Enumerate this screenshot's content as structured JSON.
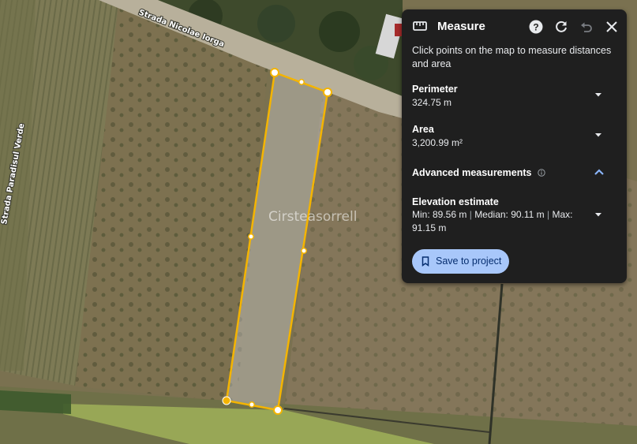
{
  "map": {
    "street_labels": [
      "Strada Nicolae Iorga",
      "Strada Paradisul Verde"
    ],
    "watermark": "Cirsteasorrell",
    "polygon_color": "#f4b400"
  },
  "panel": {
    "title": "Measure",
    "icons": [
      "ruler-icon",
      "help-icon",
      "reset-icon",
      "undo-icon",
      "close-icon"
    ],
    "instructions": "Click points on the map to measure distances and area",
    "perimeter": {
      "label": "Perimeter",
      "value": "324.75 m"
    },
    "area": {
      "label": "Area",
      "value": "3,200.99 m²"
    },
    "advanced": {
      "label": "Advanced measurements"
    },
    "elevation": {
      "label": "Elevation estimate",
      "min": "Min: 89.56 m",
      "sep": "|",
      "median": "Median: 90.11 m",
      "max": "Max:",
      "max_value": "91.15 m"
    },
    "save_label": "Save to project",
    "colors": {
      "background": "#1f1f1f",
      "button": "#a8c7fa",
      "button_text": "#062e6f"
    }
  }
}
